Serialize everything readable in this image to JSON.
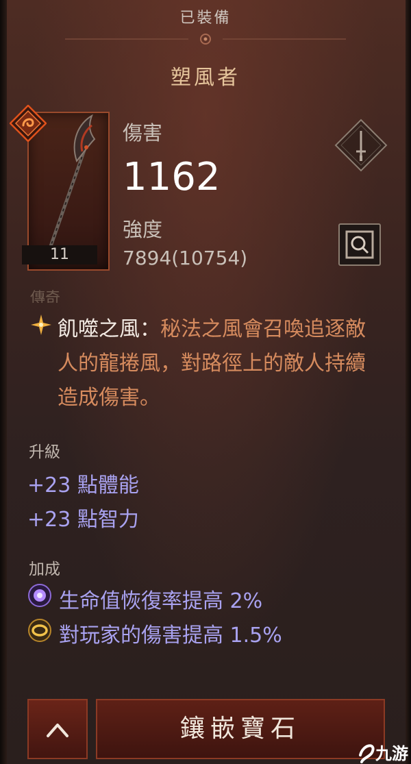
{
  "header": {
    "equipped_label": "已裝備",
    "item_name": "塑風者"
  },
  "item": {
    "level": "11",
    "damage_label": "傷害",
    "damage_value": "1162",
    "strength_label": "強度",
    "strength_value": "7894(10754)"
  },
  "aspect": {
    "cut_header": "傳奇",
    "name": "飢噬之風",
    "separator": "：",
    "description": "秘法之風會召喚追逐敵人的龍捲風，對路徑上的敵人持續造成傷害。"
  },
  "upgrade": {
    "label": "升級",
    "lines": [
      "+23 點體能",
      "+23 點智力"
    ]
  },
  "bonus": {
    "label": "加成",
    "lines": [
      "生命值恢復率提高 2%",
      "對玩家的傷害提高 1.5%"
    ],
    "icons": [
      "purple-orb-icon",
      "gold-ring-icon"
    ]
  },
  "buttons": {
    "socket_label": "鑲嵌寶石"
  },
  "watermark": {
    "text": "九游"
  },
  "colors": {
    "title": "#e6c59c",
    "aspect_text": "#d68b5e",
    "affix": "#a9a2f0",
    "legendary_badge": "#e0521c"
  }
}
